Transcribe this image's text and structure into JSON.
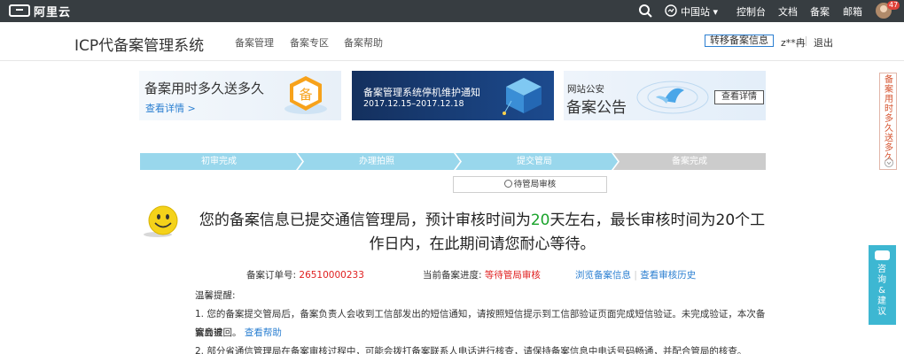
{
  "topbar": {
    "logo": "阿里云",
    "region": "中国站",
    "console": "控制台",
    "docs": "文档",
    "beian": "备案",
    "mail": "邮箱",
    "badge": "47",
    "icons": [
      "search-icon",
      "globe-icon",
      "chevron-down-icon",
      "avatar"
    ]
  },
  "header": {
    "title": "ICP代备案管理系统",
    "nav": [
      "备案管理",
      "备案专区",
      "备案帮助"
    ],
    "transfer": "转移备案信息",
    "user": "z**冉",
    "logout": "退出"
  },
  "banners": [
    {
      "title": "备案用时多久送多久",
      "link": "查看详情 >"
    },
    {
      "title": "备案管理系统停机维护通知",
      "subtitle": "2017.12.15–2017.12.18"
    },
    {
      "title": "网站公安",
      "subtitle": "备案公告",
      "button": "查看详情"
    }
  ],
  "steps": {
    "items": [
      "初审完成",
      "办理拍照",
      "提交管局",
      "备案完成"
    ],
    "current_index": 2,
    "active_color": "#99d7ec",
    "inactive_color": "#cccccc"
  },
  "status": "待管局审核",
  "message": {
    "part1": "您的备案信息已提交通信管理局，预计审核时间为",
    "days1": "20",
    "part2": "天左右，最长审核时间为20个工作日内，在此期间请您耐心等待。"
  },
  "info": {
    "order_label": "备案订单号:",
    "order_no": "26510000233",
    "progress_label": "当前备案进度:",
    "progress_value": "等待管局审核",
    "link1": "浏览备案信息",
    "link2": "查看审核历史"
  },
  "tips": {
    "heading": "温馨提醒:",
    "line1": "1. 您的备案提交管局后，备案负责人会收到工信部发出的短信通知，请按照短信提示到工信部验证页面完成短信验证。未完成验证，本次备案会被",
    "line1b": "管局退回。",
    "help": "查看帮助",
    "line2": "2. 部分省通信管理局在备案审核过程中，可能会拨打备案联系人电话进行核查，请保持备案信息中电话号码畅通，并配合管局的核查。"
  },
  "float_right": {
    "promo": "备案用时多久送多久",
    "consult": "咨询&建议"
  },
  "colors": {
    "accent": "#2b7fd1",
    "highlight_green": "#1aa32b",
    "alert_red": "#e02020",
    "topbar": "#373d41"
  }
}
